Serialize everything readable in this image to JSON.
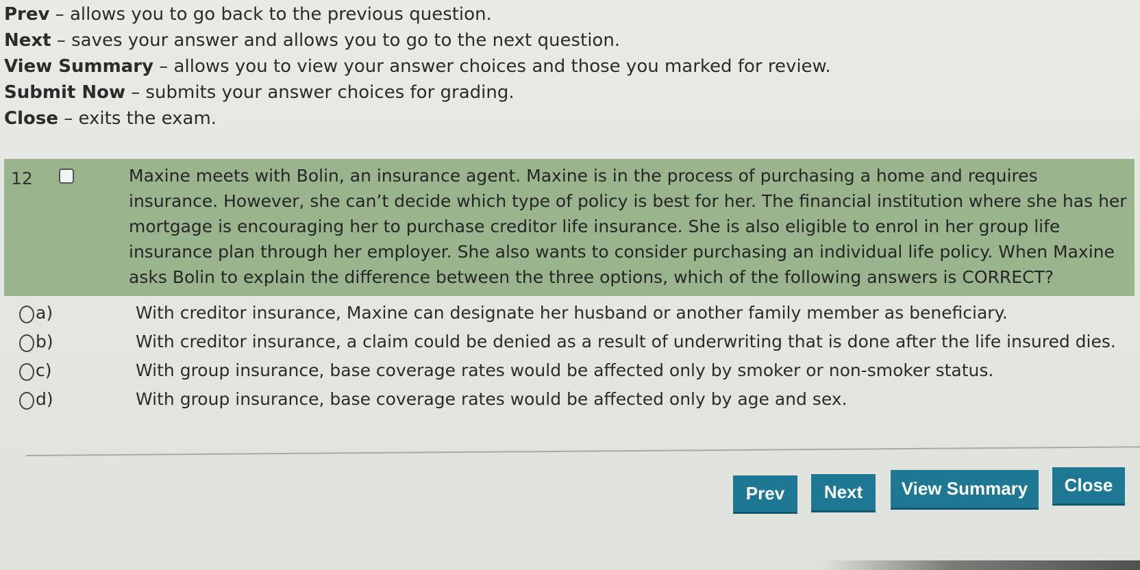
{
  "instructions": [
    {
      "key": "Prev",
      "desc": " – allows you to go back to the previous question."
    },
    {
      "key": "Next",
      "desc": " – saves your answer and allows you to go to the next question."
    },
    {
      "key": "View Summary",
      "desc": " – allows you to view your answer choices and those you marked for review."
    },
    {
      "key": "Submit Now",
      "desc": " – submits your answer choices for grading."
    },
    {
      "key": "Close",
      "desc": " – exits the exam."
    }
  ],
  "question": {
    "number": "12",
    "text": "Maxine meets with Bolin, an insurance agent. Maxine is in the process of purchasing a home and requires insurance. However, she can’t decide which type of policy is best for her. The financial institution where she has her mortgage is encouraging her to purchase creditor life insurance. She is also eligible to enrol in her group life insurance plan through her employer. She also wants to consider purchasing an individual life policy. When Maxine asks Bolin to explain the difference between the three options, which of the following answers is CORRECT?",
    "marked_for_review": false
  },
  "options": [
    {
      "letter": "a)",
      "text": "With creditor insurance, Maxine can designate her husband or another family member as beneficiary.",
      "selected": false
    },
    {
      "letter": "b)",
      "text": "With creditor insurance, a claim could be denied as a result of underwriting that is done after the life insured dies.",
      "selected": false
    },
    {
      "letter": "c)",
      "text": "With group insurance, base coverage rates would be affected only by smoker or non-smoker status.",
      "selected": false
    },
    {
      "letter": "d)",
      "text": "With group insurance, base coverage rates would be affected only by age and sex.",
      "selected": false
    }
  ],
  "buttons": {
    "prev": "Prev",
    "next": "Next",
    "view_summary": "View Summary",
    "close": "Close"
  },
  "colors": {
    "question_highlight": "#9ab58e",
    "button_bg": "#1f7893",
    "button_text": "#ffffff"
  }
}
